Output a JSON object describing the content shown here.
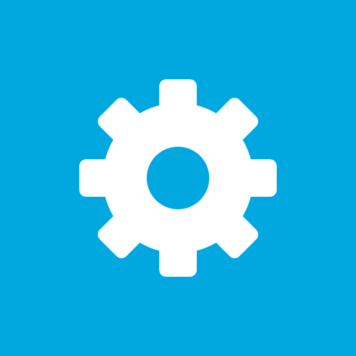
{
  "app_tile": {
    "name": "Settings",
    "icon": "gear-icon",
    "colors": {
      "background": "#00a8e0",
      "icon": "#ffffff"
    }
  }
}
